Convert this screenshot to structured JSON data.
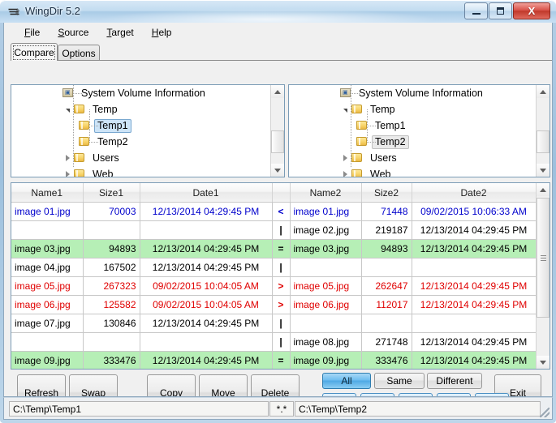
{
  "window": {
    "title": "WingDir 5.2",
    "app_icon": "wingdir-logo-icon",
    "minimize_label": "",
    "maximize_label": "",
    "close_label": "X"
  },
  "menu": {
    "items": [
      {
        "label": "File",
        "accel": "F"
      },
      {
        "label": "Source",
        "accel": "S"
      },
      {
        "label": "Target",
        "accel": "T"
      },
      {
        "label": "Help",
        "accel": "H"
      }
    ]
  },
  "tabs": [
    {
      "label": "Compare",
      "active": true
    },
    {
      "label": "Options",
      "active": false
    }
  ],
  "trees": {
    "left": {
      "nodes": [
        {
          "label": "System Volume Information",
          "indent": 1,
          "icon": "system-volume-icon",
          "state": "none",
          "selected": false
        },
        {
          "label": "Temp",
          "indent": 1,
          "icon": "folder-icon",
          "state": "expanded",
          "selected": false
        },
        {
          "label": "Temp1",
          "indent": 2,
          "icon": "folder-icon",
          "state": "none",
          "selected": true
        },
        {
          "label": "Temp2",
          "indent": 2,
          "icon": "folder-icon",
          "state": "none",
          "selected": false
        },
        {
          "label": "Users",
          "indent": 1,
          "icon": "folder-icon",
          "state": "collapsed",
          "selected": false
        },
        {
          "label": "Web",
          "indent": 1,
          "icon": "folder-icon",
          "state": "collapsed",
          "selected": false
        }
      ]
    },
    "right": {
      "nodes": [
        {
          "label": "System Volume Information",
          "indent": 1,
          "icon": "system-volume-icon",
          "state": "none",
          "selected": false
        },
        {
          "label": "Temp",
          "indent": 1,
          "icon": "folder-icon",
          "state": "expanded",
          "selected": false
        },
        {
          "label": "Temp1",
          "indent": 2,
          "icon": "folder-icon",
          "state": "none",
          "selected": false
        },
        {
          "label": "Temp2",
          "indent": 2,
          "icon": "folder-icon",
          "state": "none",
          "selected": true
        },
        {
          "label": "Users",
          "indent": 1,
          "icon": "folder-icon",
          "state": "collapsed",
          "selected": false
        },
        {
          "label": "Web",
          "indent": 1,
          "icon": "folder-icon",
          "state": "collapsed",
          "selected": false
        }
      ]
    }
  },
  "grid": {
    "columns": [
      "Name1",
      "Size1",
      "Date1",
      "",
      "Name2",
      "Size2",
      "Date2"
    ],
    "rows": [
      {
        "status": "left-newer",
        "color": "blue",
        "name1": "image 01.jpg",
        "size1": "70003",
        "date1": "12/13/2014 04:29:45 PM",
        "op": "<",
        "name2": "image 01.jpg",
        "size2": "71448",
        "date2": "09/02/2015 10:06:33 AM"
      },
      {
        "status": "right-only",
        "color": "black",
        "name1": "",
        "size1": "",
        "date1": "",
        "op": "|",
        "name2": "image 02.jpg",
        "size2": "219187",
        "date2": "12/13/2014 04:29:45 PM"
      },
      {
        "status": "same",
        "color": "black",
        "name1": "image 03.jpg",
        "size1": "94893",
        "date1": "12/13/2014 04:29:45 PM",
        "op": "=",
        "name2": "image 03.jpg",
        "size2": "94893",
        "date2": "12/13/2014 04:29:45 PM"
      },
      {
        "status": "left-only",
        "color": "black",
        "name1": "image 04.jpg",
        "size1": "167502",
        "date1": "12/13/2014 04:29:45 PM",
        "op": "|",
        "name2": "",
        "size2": "",
        "date2": ""
      },
      {
        "status": "left-newer-red",
        "color": "red",
        "name1": "image 05.jpg",
        "size1": "267323",
        "date1": "09/02/2015 10:04:05 AM",
        "op": ">",
        "name2": "image 05.jpg",
        "size2": "262647",
        "date2": "12/13/2014 04:29:45 PM"
      },
      {
        "status": "left-newer-red",
        "color": "red",
        "name1": "image 06.jpg",
        "size1": "125582",
        "date1": "09/02/2015 10:04:05 AM",
        "op": ">",
        "name2": "image 06.jpg",
        "size2": "112017",
        "date2": "12/13/2014 04:29:45 PM"
      },
      {
        "status": "left-only",
        "color": "black",
        "name1": "image 07.jpg",
        "size1": "130846",
        "date1": "12/13/2014 04:29:45 PM",
        "op": "|",
        "name2": "",
        "size2": "",
        "date2": ""
      },
      {
        "status": "right-only",
        "color": "black",
        "name1": "",
        "size1": "",
        "date1": "",
        "op": "|",
        "name2": "image 08.jpg",
        "size2": "271748",
        "date2": "12/13/2014 04:29:45 PM"
      },
      {
        "status": "same",
        "color": "black",
        "name1": "image 09.jpg",
        "size1": "333476",
        "date1": "12/13/2014 04:29:45 PM",
        "op": "=",
        "name2": "image 09.jpg",
        "size2": "333476",
        "date2": "12/13/2014 04:29:45 PM"
      }
    ]
  },
  "actions": {
    "refresh": {
      "label": "Refresh",
      "accel": "R"
    },
    "swap": {
      "label": "Swap",
      "accel": "w"
    },
    "copy": {
      "label": "Copy",
      "accel": "C"
    },
    "move": {
      "label": "Move",
      "accel": "M"
    },
    "delete": {
      "label": "Delete",
      "accel": "D"
    },
    "exit": {
      "label": "Exit",
      "accel": "x"
    }
  },
  "filters": {
    "top": [
      {
        "label": "All",
        "active": true,
        "style": "blue"
      },
      {
        "label": "Same",
        "active": false,
        "style": "gray"
      },
      {
        "label": "Different",
        "active": false,
        "style": "gray"
      }
    ],
    "bottom": [
      {
        "label": "=",
        "active": false,
        "style": "blue"
      },
      {
        "label": "|",
        "active": false,
        "style": "blue"
      },
      {
        "label": "<",
        "active": false,
        "style": "blue"
      },
      {
        "label": "+",
        "active": false,
        "style": "blue"
      },
      {
        "label": ">",
        "active": false,
        "style": "blue"
      }
    ]
  },
  "status": {
    "source_path": "C:\\Temp\\Temp1",
    "file_mask": "*.*",
    "target_path": "C:\\Temp\\Temp2"
  },
  "colors": {
    "accent": "#4fa9e4",
    "same_row": "#b6efb6",
    "newer_text": "#e00000",
    "older_text": "#0000cc",
    "title_bar": "#c2dcf0",
    "close_button": "#c0392b"
  }
}
